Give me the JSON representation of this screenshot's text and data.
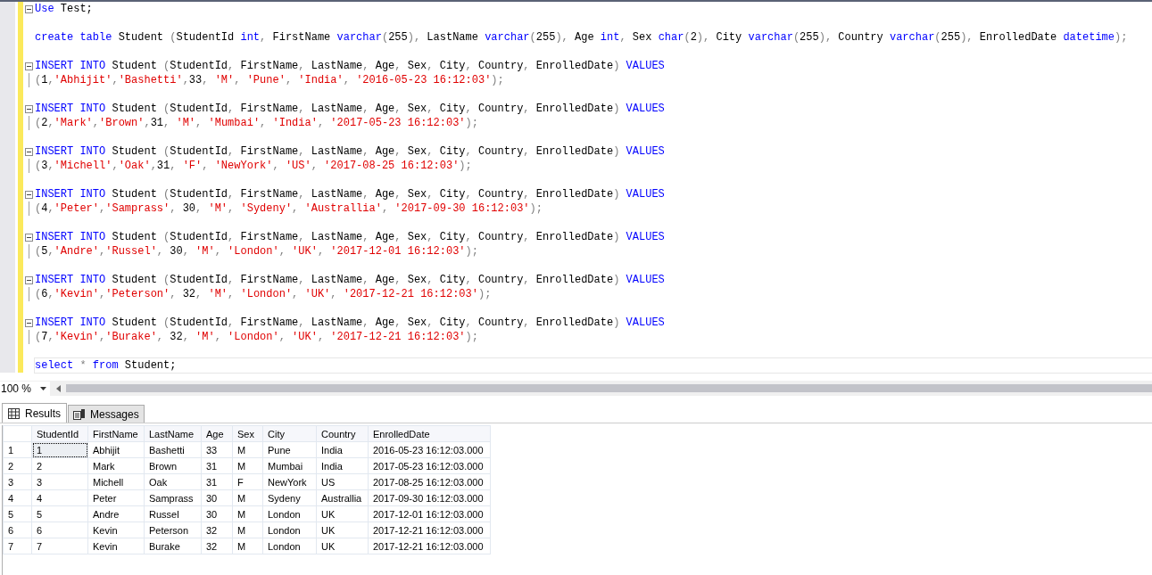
{
  "editor": {
    "statements": [
      {
        "fold": true,
        "current": false,
        "lines": [
          [
            {
              "kind": "kw",
              "text": "Use"
            },
            {
              "kind": "tx",
              "text": " Test;"
            }
          ]
        ]
      },
      {
        "fold": false,
        "current": false,
        "lines": [
          [
            {
              "kind": "kw",
              "text": "create"
            },
            {
              "kind": "kw",
              "text": " table"
            },
            {
              "kind": "tx",
              "text": " Student "
            },
            {
              "kind": "op",
              "text": "("
            },
            {
              "kind": "tx",
              "text": "StudentId "
            },
            {
              "kind": "kw",
              "text": "int"
            },
            {
              "kind": "op",
              "text": ","
            },
            {
              "kind": "tx",
              "text": " FirstName "
            },
            {
              "kind": "kw",
              "text": "varchar"
            },
            {
              "kind": "op",
              "text": "("
            },
            {
              "kind": "tx",
              "text": "255"
            },
            {
              "kind": "op",
              "text": "),"
            },
            {
              "kind": "tx",
              "text": " LastName "
            },
            {
              "kind": "kw",
              "text": "varchar"
            },
            {
              "kind": "op",
              "text": "("
            },
            {
              "kind": "tx",
              "text": "255"
            },
            {
              "kind": "op",
              "text": "),"
            },
            {
              "kind": "tx",
              "text": " Age "
            },
            {
              "kind": "kw",
              "text": "int"
            },
            {
              "kind": "op",
              "text": ","
            },
            {
              "kind": "tx",
              "text": " Sex "
            },
            {
              "kind": "kw",
              "text": "char"
            },
            {
              "kind": "op",
              "text": "("
            },
            {
              "kind": "tx",
              "text": "2"
            },
            {
              "kind": "op",
              "text": "),"
            },
            {
              "kind": "tx",
              "text": " City "
            },
            {
              "kind": "kw",
              "text": "varchar"
            },
            {
              "kind": "op",
              "text": "("
            },
            {
              "kind": "tx",
              "text": "255"
            },
            {
              "kind": "op",
              "text": "),"
            },
            {
              "kind": "tx",
              "text": " Country "
            },
            {
              "kind": "kw",
              "text": "varchar"
            },
            {
              "kind": "op",
              "text": "("
            },
            {
              "kind": "tx",
              "text": "255"
            },
            {
              "kind": "op",
              "text": "),"
            },
            {
              "kind": "tx",
              "text": " EnrolledDate "
            },
            {
              "kind": "kw",
              "text": "datetime"
            },
            {
              "kind": "op",
              "text": ");"
            }
          ]
        ]
      },
      {
        "fold": true,
        "current": false,
        "lines": [
          [
            {
              "kind": "kw",
              "text": "INSERT"
            },
            {
              "kind": "kw",
              "text": " INTO"
            },
            {
              "kind": "tx",
              "text": " Student "
            },
            {
              "kind": "op",
              "text": "("
            },
            {
              "kind": "tx",
              "text": "StudentId"
            },
            {
              "kind": "op",
              "text": ","
            },
            {
              "kind": "tx",
              "text": " FirstName"
            },
            {
              "kind": "op",
              "text": ","
            },
            {
              "kind": "tx",
              "text": " LastName"
            },
            {
              "kind": "op",
              "text": ","
            },
            {
              "kind": "tx",
              "text": " Age"
            },
            {
              "kind": "op",
              "text": ","
            },
            {
              "kind": "tx",
              "text": " Sex"
            },
            {
              "kind": "op",
              "text": ","
            },
            {
              "kind": "tx",
              "text": " City"
            },
            {
              "kind": "op",
              "text": ","
            },
            {
              "kind": "tx",
              "text": " Country"
            },
            {
              "kind": "op",
              "text": ","
            },
            {
              "kind": "tx",
              "text": " EnrolledDate"
            },
            {
              "kind": "op",
              "text": ")"
            },
            {
              "kind": "kw",
              "text": " VALUES"
            }
          ],
          [
            {
              "kind": "op",
              "text": "("
            },
            {
              "kind": "tx",
              "text": "1"
            },
            {
              "kind": "op",
              "text": ","
            },
            {
              "kind": "st",
              "text": "'Abhijit'"
            },
            {
              "kind": "op",
              "text": ","
            },
            {
              "kind": "st",
              "text": "'Bashetti'"
            },
            {
              "kind": "op",
              "text": ","
            },
            {
              "kind": "tx",
              "text": "33"
            },
            {
              "kind": "op",
              "text": ", "
            },
            {
              "kind": "st",
              "text": "'M'"
            },
            {
              "kind": "op",
              "text": ", "
            },
            {
              "kind": "st",
              "text": "'Pune'"
            },
            {
              "kind": "op",
              "text": ", "
            },
            {
              "kind": "st",
              "text": "'India'"
            },
            {
              "kind": "op",
              "text": ", "
            },
            {
              "kind": "st",
              "text": "'2016-05-23 16:12:03'"
            },
            {
              "kind": "op",
              "text": ");"
            }
          ]
        ]
      },
      {
        "fold": true,
        "current": false,
        "lines": [
          [
            {
              "kind": "kw",
              "text": "INSERT"
            },
            {
              "kind": "kw",
              "text": " INTO"
            },
            {
              "kind": "tx",
              "text": " Student "
            },
            {
              "kind": "op",
              "text": "("
            },
            {
              "kind": "tx",
              "text": "StudentId"
            },
            {
              "kind": "op",
              "text": ","
            },
            {
              "kind": "tx",
              "text": " FirstName"
            },
            {
              "kind": "op",
              "text": ","
            },
            {
              "kind": "tx",
              "text": " LastName"
            },
            {
              "kind": "op",
              "text": ","
            },
            {
              "kind": "tx",
              "text": " Age"
            },
            {
              "kind": "op",
              "text": ","
            },
            {
              "kind": "tx",
              "text": " Sex"
            },
            {
              "kind": "op",
              "text": ","
            },
            {
              "kind": "tx",
              "text": " City"
            },
            {
              "kind": "op",
              "text": ","
            },
            {
              "kind": "tx",
              "text": " Country"
            },
            {
              "kind": "op",
              "text": ","
            },
            {
              "kind": "tx",
              "text": " EnrolledDate"
            },
            {
              "kind": "op",
              "text": ")"
            },
            {
              "kind": "kw",
              "text": " VALUES"
            }
          ],
          [
            {
              "kind": "op",
              "text": "("
            },
            {
              "kind": "tx",
              "text": "2"
            },
            {
              "kind": "op",
              "text": ","
            },
            {
              "kind": "st",
              "text": "'Mark'"
            },
            {
              "kind": "op",
              "text": ","
            },
            {
              "kind": "st",
              "text": "'Brown'"
            },
            {
              "kind": "op",
              "text": ","
            },
            {
              "kind": "tx",
              "text": "31"
            },
            {
              "kind": "op",
              "text": ", "
            },
            {
              "kind": "st",
              "text": "'M'"
            },
            {
              "kind": "op",
              "text": ", "
            },
            {
              "kind": "st",
              "text": "'Mumbai'"
            },
            {
              "kind": "op",
              "text": ", "
            },
            {
              "kind": "st",
              "text": "'India'"
            },
            {
              "kind": "op",
              "text": ", "
            },
            {
              "kind": "st",
              "text": "'2017-05-23 16:12:03'"
            },
            {
              "kind": "op",
              "text": ");"
            }
          ]
        ]
      },
      {
        "fold": true,
        "current": false,
        "lines": [
          [
            {
              "kind": "kw",
              "text": "INSERT"
            },
            {
              "kind": "kw",
              "text": " INTO"
            },
            {
              "kind": "tx",
              "text": " Student "
            },
            {
              "kind": "op",
              "text": "("
            },
            {
              "kind": "tx",
              "text": "StudentId"
            },
            {
              "kind": "op",
              "text": ","
            },
            {
              "kind": "tx",
              "text": " FirstName"
            },
            {
              "kind": "op",
              "text": ","
            },
            {
              "kind": "tx",
              "text": " LastName"
            },
            {
              "kind": "op",
              "text": ","
            },
            {
              "kind": "tx",
              "text": " Age"
            },
            {
              "kind": "op",
              "text": ","
            },
            {
              "kind": "tx",
              "text": " Sex"
            },
            {
              "kind": "op",
              "text": ","
            },
            {
              "kind": "tx",
              "text": " City"
            },
            {
              "kind": "op",
              "text": ","
            },
            {
              "kind": "tx",
              "text": " Country"
            },
            {
              "kind": "op",
              "text": ","
            },
            {
              "kind": "tx",
              "text": " EnrolledDate"
            },
            {
              "kind": "op",
              "text": ")"
            },
            {
              "kind": "kw",
              "text": " VALUES"
            }
          ],
          [
            {
              "kind": "op",
              "text": "("
            },
            {
              "kind": "tx",
              "text": "3"
            },
            {
              "kind": "op",
              "text": ","
            },
            {
              "kind": "st",
              "text": "'Michell'"
            },
            {
              "kind": "op",
              "text": ","
            },
            {
              "kind": "st",
              "text": "'Oak'"
            },
            {
              "kind": "op",
              "text": ","
            },
            {
              "kind": "tx",
              "text": "31"
            },
            {
              "kind": "op",
              "text": ", "
            },
            {
              "kind": "st",
              "text": "'F'"
            },
            {
              "kind": "op",
              "text": ", "
            },
            {
              "kind": "st",
              "text": "'NewYork'"
            },
            {
              "kind": "op",
              "text": ", "
            },
            {
              "kind": "st",
              "text": "'US'"
            },
            {
              "kind": "op",
              "text": ", "
            },
            {
              "kind": "st",
              "text": "'2017-08-25 16:12:03'"
            },
            {
              "kind": "op",
              "text": ");"
            }
          ]
        ]
      },
      {
        "fold": true,
        "current": false,
        "lines": [
          [
            {
              "kind": "kw",
              "text": "INSERT"
            },
            {
              "kind": "kw",
              "text": " INTO"
            },
            {
              "kind": "tx",
              "text": " Student "
            },
            {
              "kind": "op",
              "text": "("
            },
            {
              "kind": "tx",
              "text": "StudentId"
            },
            {
              "kind": "op",
              "text": ","
            },
            {
              "kind": "tx",
              "text": " FirstName"
            },
            {
              "kind": "op",
              "text": ","
            },
            {
              "kind": "tx",
              "text": " LastName"
            },
            {
              "kind": "op",
              "text": ","
            },
            {
              "kind": "tx",
              "text": " Age"
            },
            {
              "kind": "op",
              "text": ","
            },
            {
              "kind": "tx",
              "text": " Sex"
            },
            {
              "kind": "op",
              "text": ","
            },
            {
              "kind": "tx",
              "text": " City"
            },
            {
              "kind": "op",
              "text": ","
            },
            {
              "kind": "tx",
              "text": " Country"
            },
            {
              "kind": "op",
              "text": ","
            },
            {
              "kind": "tx",
              "text": " EnrolledDate"
            },
            {
              "kind": "op",
              "text": ")"
            },
            {
              "kind": "kw",
              "text": " VALUES"
            }
          ],
          [
            {
              "kind": "op",
              "text": "("
            },
            {
              "kind": "tx",
              "text": "4"
            },
            {
              "kind": "op",
              "text": ","
            },
            {
              "kind": "st",
              "text": "'Peter'"
            },
            {
              "kind": "op",
              "text": ","
            },
            {
              "kind": "st",
              "text": "'Samprass'"
            },
            {
              "kind": "op",
              "text": ", "
            },
            {
              "kind": "tx",
              "text": "30"
            },
            {
              "kind": "op",
              "text": ", "
            },
            {
              "kind": "st",
              "text": "'M'"
            },
            {
              "kind": "op",
              "text": ", "
            },
            {
              "kind": "st",
              "text": "'Sydeny'"
            },
            {
              "kind": "op",
              "text": ", "
            },
            {
              "kind": "st",
              "text": "'Australlia'"
            },
            {
              "kind": "op",
              "text": ", "
            },
            {
              "kind": "st",
              "text": "'2017-09-30 16:12:03'"
            },
            {
              "kind": "op",
              "text": ");"
            }
          ]
        ]
      },
      {
        "fold": true,
        "current": false,
        "lines": [
          [
            {
              "kind": "kw",
              "text": "INSERT"
            },
            {
              "kind": "kw",
              "text": " INTO"
            },
            {
              "kind": "tx",
              "text": " Student "
            },
            {
              "kind": "op",
              "text": "("
            },
            {
              "kind": "tx",
              "text": "StudentId"
            },
            {
              "kind": "op",
              "text": ","
            },
            {
              "kind": "tx",
              "text": " FirstName"
            },
            {
              "kind": "op",
              "text": ","
            },
            {
              "kind": "tx",
              "text": " LastName"
            },
            {
              "kind": "op",
              "text": ","
            },
            {
              "kind": "tx",
              "text": " Age"
            },
            {
              "kind": "op",
              "text": ","
            },
            {
              "kind": "tx",
              "text": " Sex"
            },
            {
              "kind": "op",
              "text": ","
            },
            {
              "kind": "tx",
              "text": " City"
            },
            {
              "kind": "op",
              "text": ","
            },
            {
              "kind": "tx",
              "text": " Country"
            },
            {
              "kind": "op",
              "text": ","
            },
            {
              "kind": "tx",
              "text": " EnrolledDate"
            },
            {
              "kind": "op",
              "text": ")"
            },
            {
              "kind": "kw",
              "text": " VALUES"
            }
          ],
          [
            {
              "kind": "op",
              "text": "("
            },
            {
              "kind": "tx",
              "text": "5"
            },
            {
              "kind": "op",
              "text": ","
            },
            {
              "kind": "st",
              "text": "'Andre'"
            },
            {
              "kind": "op",
              "text": ","
            },
            {
              "kind": "st",
              "text": "'Russel'"
            },
            {
              "kind": "op",
              "text": ", "
            },
            {
              "kind": "tx",
              "text": "30"
            },
            {
              "kind": "op",
              "text": ", "
            },
            {
              "kind": "st",
              "text": "'M'"
            },
            {
              "kind": "op",
              "text": ", "
            },
            {
              "kind": "st",
              "text": "'London'"
            },
            {
              "kind": "op",
              "text": ", "
            },
            {
              "kind": "st",
              "text": "'UK'"
            },
            {
              "kind": "op",
              "text": ", "
            },
            {
              "kind": "st",
              "text": "'2017-12-01 16:12:03'"
            },
            {
              "kind": "op",
              "text": ");"
            }
          ]
        ]
      },
      {
        "fold": true,
        "current": false,
        "lines": [
          [
            {
              "kind": "kw",
              "text": "INSERT"
            },
            {
              "kind": "kw",
              "text": " INTO"
            },
            {
              "kind": "tx",
              "text": " Student "
            },
            {
              "kind": "op",
              "text": "("
            },
            {
              "kind": "tx",
              "text": "StudentId"
            },
            {
              "kind": "op",
              "text": ","
            },
            {
              "kind": "tx",
              "text": " FirstName"
            },
            {
              "kind": "op",
              "text": ","
            },
            {
              "kind": "tx",
              "text": " LastName"
            },
            {
              "kind": "op",
              "text": ","
            },
            {
              "kind": "tx",
              "text": " Age"
            },
            {
              "kind": "op",
              "text": ","
            },
            {
              "kind": "tx",
              "text": " Sex"
            },
            {
              "kind": "op",
              "text": ","
            },
            {
              "kind": "tx",
              "text": " City"
            },
            {
              "kind": "op",
              "text": ","
            },
            {
              "kind": "tx",
              "text": " Country"
            },
            {
              "kind": "op",
              "text": ","
            },
            {
              "kind": "tx",
              "text": " EnrolledDate"
            },
            {
              "kind": "op",
              "text": ")"
            },
            {
              "kind": "kw",
              "text": " VALUES"
            }
          ],
          [
            {
              "kind": "op",
              "text": "("
            },
            {
              "kind": "tx",
              "text": "6"
            },
            {
              "kind": "op",
              "text": ","
            },
            {
              "kind": "st",
              "text": "'Kevin'"
            },
            {
              "kind": "op",
              "text": ","
            },
            {
              "kind": "st",
              "text": "'Peterson'"
            },
            {
              "kind": "op",
              "text": ", "
            },
            {
              "kind": "tx",
              "text": "32"
            },
            {
              "kind": "op",
              "text": ", "
            },
            {
              "kind": "st",
              "text": "'M'"
            },
            {
              "kind": "op",
              "text": ", "
            },
            {
              "kind": "st",
              "text": "'London'"
            },
            {
              "kind": "op",
              "text": ", "
            },
            {
              "kind": "st",
              "text": "'UK'"
            },
            {
              "kind": "op",
              "text": ", "
            },
            {
              "kind": "st",
              "text": "'2017-12-21 16:12:03'"
            },
            {
              "kind": "op",
              "text": ");"
            }
          ]
        ]
      },
      {
        "fold": true,
        "current": false,
        "lines": [
          [
            {
              "kind": "kw",
              "text": "INSERT"
            },
            {
              "kind": "kw",
              "text": " INTO"
            },
            {
              "kind": "tx",
              "text": " Student "
            },
            {
              "kind": "op",
              "text": "("
            },
            {
              "kind": "tx",
              "text": "StudentId"
            },
            {
              "kind": "op",
              "text": ","
            },
            {
              "kind": "tx",
              "text": " FirstName"
            },
            {
              "kind": "op",
              "text": ","
            },
            {
              "kind": "tx",
              "text": " LastName"
            },
            {
              "kind": "op",
              "text": ","
            },
            {
              "kind": "tx",
              "text": " Age"
            },
            {
              "kind": "op",
              "text": ","
            },
            {
              "kind": "tx",
              "text": " Sex"
            },
            {
              "kind": "op",
              "text": ","
            },
            {
              "kind": "tx",
              "text": " City"
            },
            {
              "kind": "op",
              "text": ","
            },
            {
              "kind": "tx",
              "text": " Country"
            },
            {
              "kind": "op",
              "text": ","
            },
            {
              "kind": "tx",
              "text": " EnrolledDate"
            },
            {
              "kind": "op",
              "text": ")"
            },
            {
              "kind": "kw",
              "text": " VALUES"
            }
          ],
          [
            {
              "kind": "op",
              "text": "("
            },
            {
              "kind": "tx",
              "text": "7"
            },
            {
              "kind": "op",
              "text": ","
            },
            {
              "kind": "st",
              "text": "'Kevin'"
            },
            {
              "kind": "op",
              "text": ","
            },
            {
              "kind": "st",
              "text": "'Burake'"
            },
            {
              "kind": "op",
              "text": ", "
            },
            {
              "kind": "tx",
              "text": "32"
            },
            {
              "kind": "op",
              "text": ", "
            },
            {
              "kind": "st",
              "text": "'M'"
            },
            {
              "kind": "op",
              "text": ", "
            },
            {
              "kind": "st",
              "text": "'London'"
            },
            {
              "kind": "op",
              "text": ", "
            },
            {
              "kind": "st",
              "text": "'UK'"
            },
            {
              "kind": "op",
              "text": ", "
            },
            {
              "kind": "st",
              "text": "'2017-12-21 16:12:03'"
            },
            {
              "kind": "op",
              "text": ");"
            }
          ]
        ]
      },
      {
        "fold": false,
        "current": true,
        "lines": [
          [
            {
              "kind": "kw",
              "text": "select"
            },
            {
              "kind": "op",
              "text": " * "
            },
            {
              "kind": "kw",
              "text": "from"
            },
            {
              "kind": "tx",
              "text": " Student;"
            }
          ]
        ]
      }
    ]
  },
  "zoom": {
    "value": "100 %"
  },
  "tabs": [
    {
      "label": "Results",
      "selected": true
    },
    {
      "label": "Messages",
      "selected": false
    }
  ],
  "results": {
    "columns": [
      "StudentId",
      "FirstName",
      "LastName",
      "Age",
      "Sex",
      "City",
      "Country",
      "EnrolledDate"
    ],
    "rows": [
      {
        "number": "1",
        "focused": true,
        "cells": [
          "1",
          "Abhijit",
          "Bashetti",
          "33",
          "M",
          "Pune",
          "India",
          "2016-05-23 16:12:03.000"
        ]
      },
      {
        "number": "2",
        "focused": false,
        "cells": [
          "2",
          "Mark",
          "Brown",
          "31",
          "M",
          "Mumbai",
          "India",
          "2017-05-23 16:12:03.000"
        ]
      },
      {
        "number": "3",
        "focused": false,
        "cells": [
          "3",
          "Michell",
          "Oak",
          "31",
          "F",
          "NewYork",
          "US",
          "2017-08-25 16:12:03.000"
        ]
      },
      {
        "number": "4",
        "focused": false,
        "cells": [
          "4",
          "Peter",
          "Samprass",
          "30",
          "M",
          "Sydeny",
          "Australlia",
          "2017-09-30 16:12:03.000"
        ]
      },
      {
        "number": "5",
        "focused": false,
        "cells": [
          "5",
          "Andre",
          "Russel",
          "30",
          "M",
          "London",
          "UK",
          "2017-12-01 16:12:03.000"
        ]
      },
      {
        "number": "6",
        "focused": false,
        "cells": [
          "6",
          "Kevin",
          "Peterson",
          "32",
          "M",
          "London",
          "UK",
          "2017-12-21 16:12:03.000"
        ]
      },
      {
        "number": "7",
        "focused": false,
        "cells": [
          "7",
          "Kevin",
          "Burake",
          "32",
          "M",
          "London",
          "UK",
          "2017-12-21 16:12:03.000"
        ]
      }
    ]
  }
}
